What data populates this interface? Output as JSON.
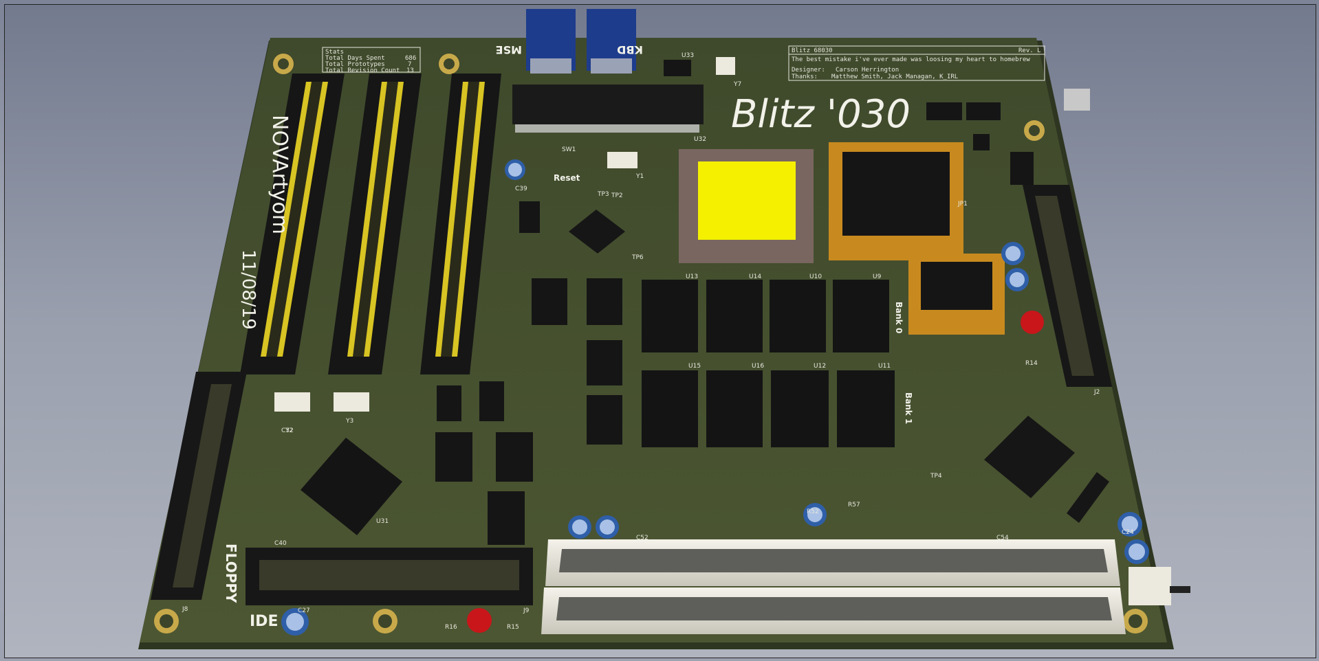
{
  "board": {
    "title": "Blitz '030",
    "author_side_text": "NOVArtyom",
    "date_side_text": "11/08/19"
  },
  "stats_box": {
    "heading": "Stats",
    "rows": [
      {
        "label": "Total Days Spent",
        "value": "686"
      },
      {
        "label": "Total Prototypes",
        "value": "7"
      },
      {
        "label": "Total Revision Count",
        "value": "13"
      }
    ]
  },
  "title_block": {
    "name": "Blitz 68030",
    "revision": "Rev. L",
    "quote": "The best mistake i've ever made was loosing my heart to homebrew",
    "designer_label": "Designer:",
    "designer": "Carson Herrington",
    "thanks_label": "Thanks:",
    "thanks": "Matthew Smith, Jack Managan, K_IRL"
  },
  "connector_labels": {
    "floppy": "FLOPPY",
    "ide": "IDE",
    "kbd": "KBD",
    "mse": "MSE",
    "reset": "Reset",
    "bank0": "Bank 0",
    "bank1": "Bank 1"
  },
  "refdes": {
    "sw1": "SW1",
    "y1": "Y1",
    "y2": "Y2",
    "y3": "Y3",
    "y7": "Y7",
    "u32": "U32",
    "u33": "U33",
    "u31": "U31",
    "u13": "U13",
    "u14": "U14",
    "u10": "U10",
    "u9": "U9",
    "u15": "U15",
    "u16": "U16",
    "u12": "U12",
    "u11": "U11",
    "j2": "J2",
    "j8": "J8",
    "j9": "J9",
    "c39": "C39",
    "c32": "C32",
    "c40": "C40",
    "c27": "C27",
    "c24": "C24",
    "c52": "C52",
    "c54": "C54",
    "c22": "C22",
    "r16": "R16",
    "r15": "R15",
    "r14": "R14",
    "r52": "R52",
    "r57": "R57",
    "tp3": "TP3",
    "tp2": "TP2",
    "tp6": "TP6",
    "tp4": "TP4",
    "jp1": "JP1"
  }
}
